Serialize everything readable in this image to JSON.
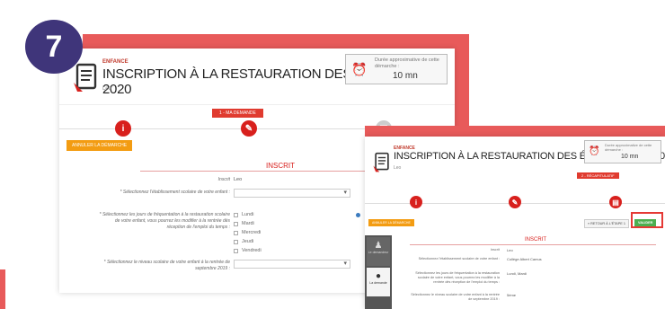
{
  "step_badge": "7",
  "colors": {
    "accent_red": "#d8201d",
    "badge_purple": "#3f357a",
    "cancel_orange": "#f39c12",
    "validate_green": "#4caf50"
  },
  "screen1": {
    "category": "ENFANCE",
    "title": "INSCRIPTION À LA RESTAURATION DES ÉLÈVES 2019-2020",
    "subtitle": "Leo",
    "duration_label": "Durée approximative de cette démarche :",
    "duration_value": "10 mn",
    "step_label": "1 - MA DEMANDE",
    "steps_icons": [
      "info-icon",
      "pencil-icon",
      "form-icon"
    ],
    "cancel_label": "ANNULER LA DÉMARCHE",
    "section_title": "INSCRIT",
    "inscrit_label": "Inscrit",
    "inscrit_value": "Leo",
    "school_label": "* Sélectionnez l'établissement scolaire de votre enfant :",
    "days_label": "* Sélectionnez les jours de fréquentation à la restauration scolaire de votre enfant, vous pourrez les modifier à la rentrée dès réception de l'emploi du temps :",
    "days": [
      "Lundi",
      "Mardi",
      "Mercredi",
      "Jeudi",
      "Vendredi"
    ],
    "level_label": "* Sélectionnez le niveau scolaire de votre enfant à la rentrée de septembre 2019 :"
  },
  "screen2": {
    "category": "ENFANCE",
    "title": "INSCRIPTION À LA RESTAURATION DES ÉLÈVES 2019-2020",
    "subtitle": "Leo",
    "duration_label": "Durée approximative de cette démarche :",
    "duration_value": "10 mn",
    "step_label": "2 - RÉCAPITULATIF",
    "cancel_label": "ANNULER LA DÉMARCHE",
    "back_label": "« RETOUR À L'ÉTAPE 1",
    "validate_label": "VALIDER",
    "sidebar": [
      {
        "label": "Le demandeur",
        "icon": "person-icon"
      },
      {
        "label": "La demande",
        "icon": "chat-icon"
      }
    ],
    "section_title": "INSCRIT",
    "inscrit_label": "Inscrit",
    "inscrit_value": "Leo",
    "school_label": "Sélectionnez l'établissement scolaire de votre enfant :",
    "school_value": "Collège Albert Camus",
    "days_label": "Sélectionnez les jours de fréquentation à la restauration scolaire de votre enfant, vous pourrez les modifier à la rentrée dès réception de l'emploi du temps :",
    "days_value": "Lundi, Mardi",
    "level_label": "Sélectionnez le niveau scolaire de votre enfant à la rentrée de septembre 2019 :",
    "level_value": "5ème"
  }
}
